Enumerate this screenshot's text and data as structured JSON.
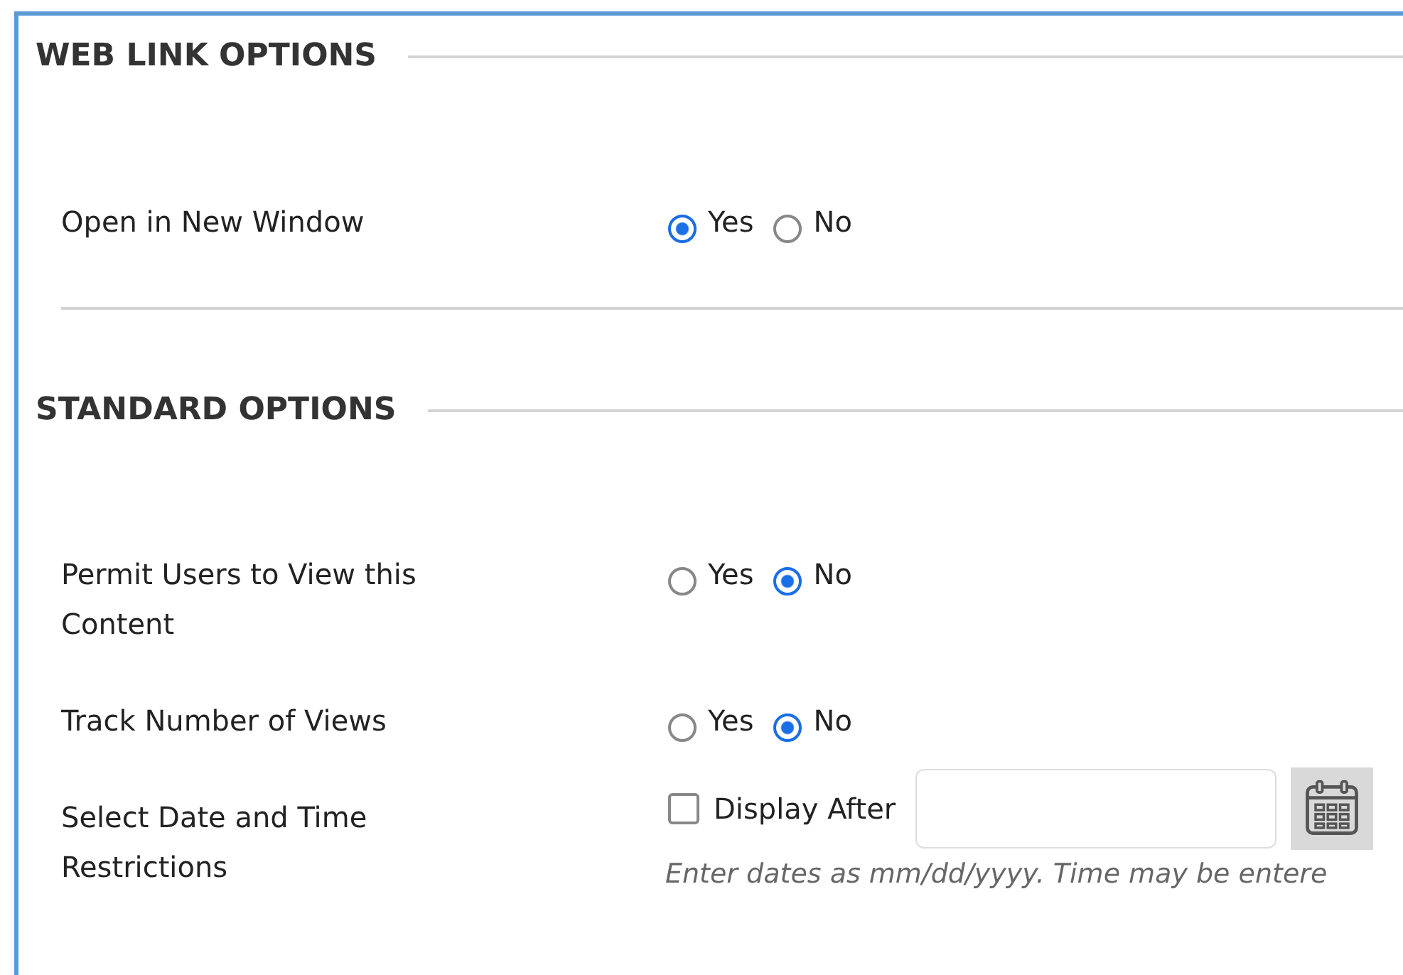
{
  "sections": [
    {
      "title": "WEB LINK OPTIONS",
      "rows": [
        {
          "kind": "radio",
          "label": "Open in New Window",
          "options": [
            {
              "label": "Yes",
              "selected": true
            },
            {
              "label": "No",
              "selected": false
            }
          ]
        }
      ]
    },
    {
      "title": "STANDARD OPTIONS",
      "rows": [
        {
          "kind": "radio",
          "label": "Permit Users to View this Content",
          "options": [
            {
              "label": "Yes",
              "selected": false
            },
            {
              "label": "No",
              "selected": true
            }
          ]
        },
        {
          "kind": "radio",
          "label": "Track Number of Views",
          "options": [
            {
              "label": "Yes",
              "selected": false
            },
            {
              "label": "No",
              "selected": true
            }
          ]
        },
        {
          "kind": "date",
          "label": "Select Date and Time Restrictions",
          "checkbox": {
            "label": "Display After",
            "checked": false
          },
          "hint": "Enter dates as mm/dd/yyyy. Time may be entere"
        }
      ]
    }
  ]
}
